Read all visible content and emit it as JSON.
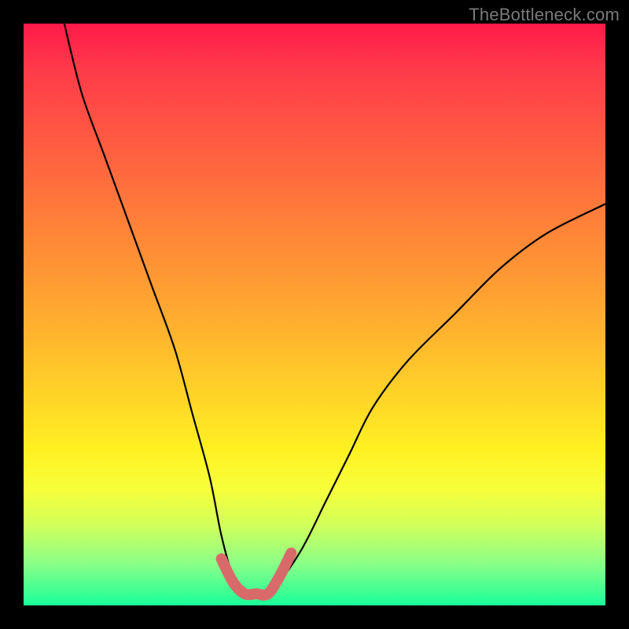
{
  "watermark": "TheBottleneck.com",
  "chart_data": {
    "type": "line",
    "title": "",
    "xlabel": "",
    "ylabel": "",
    "xlim": [
      0,
      100
    ],
    "ylim": [
      0,
      100
    ],
    "series": [
      {
        "name": "bottleneck-curve",
        "x": [
          7,
          10,
          14,
          18,
          22,
          26,
          29,
          32,
          34,
          36,
          38,
          40,
          42,
          44,
          48,
          52,
          56,
          60,
          66,
          74,
          82,
          90,
          100
        ],
        "y": [
          100,
          88,
          77,
          66,
          55,
          44,
          33,
          22,
          12,
          5,
          2,
          2,
          2,
          4,
          10,
          18,
          26,
          34,
          42,
          50,
          58,
          64,
          69
        ]
      },
      {
        "name": "highlight-trough",
        "x": [
          34,
          36,
          38,
          40,
          42,
          44,
          46
        ],
        "y": [
          8,
          4,
          2,
          2,
          2,
          5,
          9
        ]
      }
    ],
    "colors": {
      "curve": "#000000",
      "highlight": "#d96a6a",
      "gradient_top": "#ff1a4a",
      "gradient_bottom": "#1aff9a"
    }
  }
}
